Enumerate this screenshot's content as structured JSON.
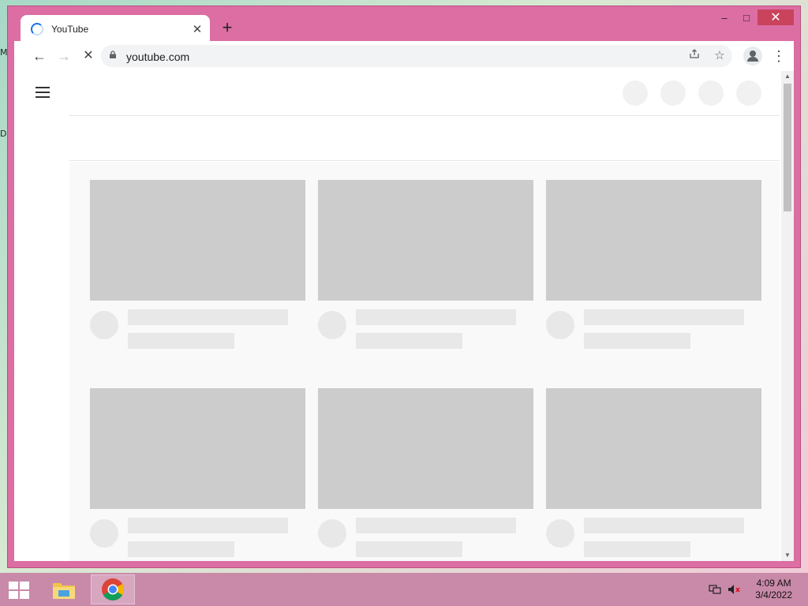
{
  "desktop": {
    "frag1": "M",
    "frag2": "D"
  },
  "browser": {
    "tab": {
      "title": "YouTube",
      "close": "✕"
    },
    "new_tab": "+",
    "window_controls": {
      "minimize": "–",
      "maximize": "□",
      "close": "✕"
    },
    "nav": {
      "back": "←",
      "forward": "→",
      "stop": "✕"
    },
    "address": {
      "url": "youtube.com"
    },
    "icons": {
      "share": "share-icon",
      "bookmark": "star-icon",
      "profile": "profile-icon",
      "menu": "more-vert-icon"
    }
  },
  "page": {
    "cards_per_row": 3,
    "card_rows": 2,
    "skeleton_color": "#cccccc"
  },
  "taskbar": {
    "apps": [
      "windows-start",
      "file-explorer",
      "chrome"
    ],
    "clock": {
      "time": "4:09 AM",
      "date": "3/4/2022"
    }
  },
  "colors": {
    "window_frame": "#dc6ea4",
    "taskbar": "#c98aa9",
    "close_button": "#c9435c"
  }
}
